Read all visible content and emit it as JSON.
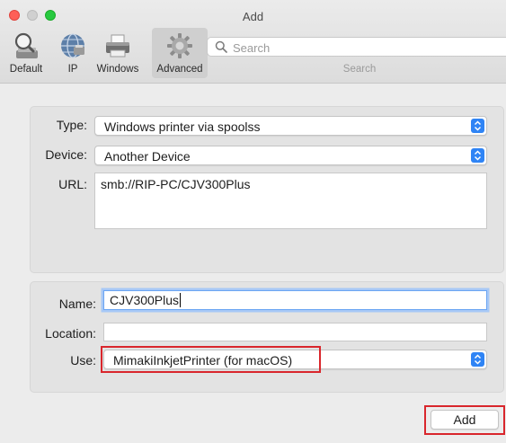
{
  "window": {
    "title": "Add"
  },
  "toolbar": {
    "items": [
      {
        "label": "Default",
        "icon": "default-printers-icon"
      },
      {
        "label": "IP",
        "icon": "globe-icon"
      },
      {
        "label": "Windows",
        "icon": "printer-icon"
      },
      {
        "label": "Advanced",
        "icon": "gear-icon",
        "selected": true
      }
    ],
    "search": {
      "placeholder": "Search",
      "caption": "Search"
    }
  },
  "connection": {
    "type_label": "Type:",
    "type_value": "Windows printer via spoolss",
    "device_label": "Device:",
    "device_value": "Another Device",
    "url_label": "URL:",
    "url_value": "smb://RIP-PC/CJV300Plus"
  },
  "printer": {
    "name_label": "Name:",
    "name_value": "CJV300Plus",
    "location_label": "Location:",
    "location_value": "",
    "use_label": "Use:",
    "use_value": "MimakiInkjetPrinter (for macOS)"
  },
  "actions": {
    "add_label": "Add"
  },
  "colors": {
    "accent": "#2f84f5",
    "highlight": "#d9262c",
    "close": "#fe5f57",
    "maximize": "#27c93f"
  }
}
